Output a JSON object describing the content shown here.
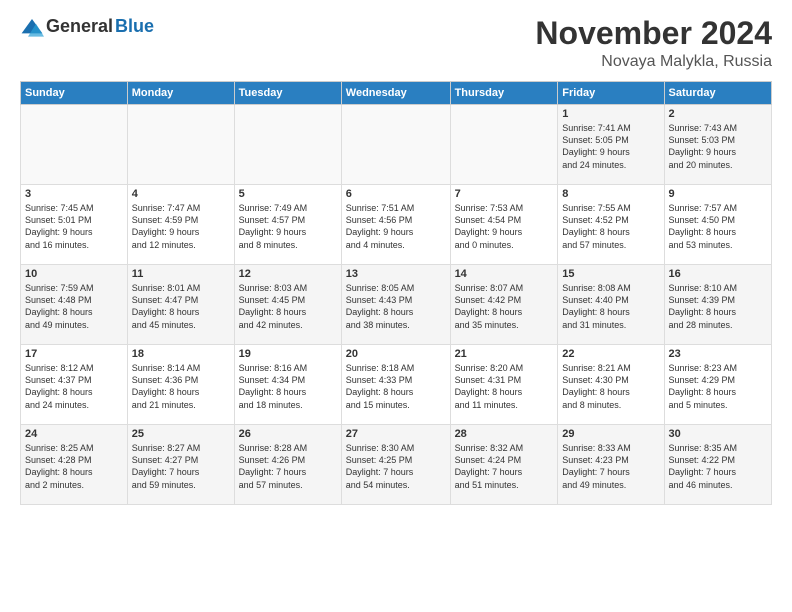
{
  "header": {
    "logo_general": "General",
    "logo_blue": "Blue",
    "month_title": "November 2024",
    "location": "Novaya Malykla, Russia"
  },
  "weekdays": [
    "Sunday",
    "Monday",
    "Tuesday",
    "Wednesday",
    "Thursday",
    "Friday",
    "Saturday"
  ],
  "weeks": [
    [
      {
        "day": "",
        "info": ""
      },
      {
        "day": "",
        "info": ""
      },
      {
        "day": "",
        "info": ""
      },
      {
        "day": "",
        "info": ""
      },
      {
        "day": "",
        "info": ""
      },
      {
        "day": "1",
        "info": "Sunrise: 7:41 AM\nSunset: 5:05 PM\nDaylight: 9 hours\nand 24 minutes."
      },
      {
        "day": "2",
        "info": "Sunrise: 7:43 AM\nSunset: 5:03 PM\nDaylight: 9 hours\nand 20 minutes."
      }
    ],
    [
      {
        "day": "3",
        "info": "Sunrise: 7:45 AM\nSunset: 5:01 PM\nDaylight: 9 hours\nand 16 minutes."
      },
      {
        "day": "4",
        "info": "Sunrise: 7:47 AM\nSunset: 4:59 PM\nDaylight: 9 hours\nand 12 minutes."
      },
      {
        "day": "5",
        "info": "Sunrise: 7:49 AM\nSunset: 4:57 PM\nDaylight: 9 hours\nand 8 minutes."
      },
      {
        "day": "6",
        "info": "Sunrise: 7:51 AM\nSunset: 4:56 PM\nDaylight: 9 hours\nand 4 minutes."
      },
      {
        "day": "7",
        "info": "Sunrise: 7:53 AM\nSunset: 4:54 PM\nDaylight: 9 hours\nand 0 minutes."
      },
      {
        "day": "8",
        "info": "Sunrise: 7:55 AM\nSunset: 4:52 PM\nDaylight: 8 hours\nand 57 minutes."
      },
      {
        "day": "9",
        "info": "Sunrise: 7:57 AM\nSunset: 4:50 PM\nDaylight: 8 hours\nand 53 minutes."
      }
    ],
    [
      {
        "day": "10",
        "info": "Sunrise: 7:59 AM\nSunset: 4:48 PM\nDaylight: 8 hours\nand 49 minutes."
      },
      {
        "day": "11",
        "info": "Sunrise: 8:01 AM\nSunset: 4:47 PM\nDaylight: 8 hours\nand 45 minutes."
      },
      {
        "day": "12",
        "info": "Sunrise: 8:03 AM\nSunset: 4:45 PM\nDaylight: 8 hours\nand 42 minutes."
      },
      {
        "day": "13",
        "info": "Sunrise: 8:05 AM\nSunset: 4:43 PM\nDaylight: 8 hours\nand 38 minutes."
      },
      {
        "day": "14",
        "info": "Sunrise: 8:07 AM\nSunset: 4:42 PM\nDaylight: 8 hours\nand 35 minutes."
      },
      {
        "day": "15",
        "info": "Sunrise: 8:08 AM\nSunset: 4:40 PM\nDaylight: 8 hours\nand 31 minutes."
      },
      {
        "day": "16",
        "info": "Sunrise: 8:10 AM\nSunset: 4:39 PM\nDaylight: 8 hours\nand 28 minutes."
      }
    ],
    [
      {
        "day": "17",
        "info": "Sunrise: 8:12 AM\nSunset: 4:37 PM\nDaylight: 8 hours\nand 24 minutes."
      },
      {
        "day": "18",
        "info": "Sunrise: 8:14 AM\nSunset: 4:36 PM\nDaylight: 8 hours\nand 21 minutes."
      },
      {
        "day": "19",
        "info": "Sunrise: 8:16 AM\nSunset: 4:34 PM\nDaylight: 8 hours\nand 18 minutes."
      },
      {
        "day": "20",
        "info": "Sunrise: 8:18 AM\nSunset: 4:33 PM\nDaylight: 8 hours\nand 15 minutes."
      },
      {
        "day": "21",
        "info": "Sunrise: 8:20 AM\nSunset: 4:31 PM\nDaylight: 8 hours\nand 11 minutes."
      },
      {
        "day": "22",
        "info": "Sunrise: 8:21 AM\nSunset: 4:30 PM\nDaylight: 8 hours\nand 8 minutes."
      },
      {
        "day": "23",
        "info": "Sunrise: 8:23 AM\nSunset: 4:29 PM\nDaylight: 8 hours\nand 5 minutes."
      }
    ],
    [
      {
        "day": "24",
        "info": "Sunrise: 8:25 AM\nSunset: 4:28 PM\nDaylight: 8 hours\nand 2 minutes."
      },
      {
        "day": "25",
        "info": "Sunrise: 8:27 AM\nSunset: 4:27 PM\nDaylight: 7 hours\nand 59 minutes."
      },
      {
        "day": "26",
        "info": "Sunrise: 8:28 AM\nSunset: 4:26 PM\nDaylight: 7 hours\nand 57 minutes."
      },
      {
        "day": "27",
        "info": "Sunrise: 8:30 AM\nSunset: 4:25 PM\nDaylight: 7 hours\nand 54 minutes."
      },
      {
        "day": "28",
        "info": "Sunrise: 8:32 AM\nSunset: 4:24 PM\nDaylight: 7 hours\nand 51 minutes."
      },
      {
        "day": "29",
        "info": "Sunrise: 8:33 AM\nSunset: 4:23 PM\nDaylight: 7 hours\nand 49 minutes."
      },
      {
        "day": "30",
        "info": "Sunrise: 8:35 AM\nSunset: 4:22 PM\nDaylight: 7 hours\nand 46 minutes."
      }
    ]
  ]
}
